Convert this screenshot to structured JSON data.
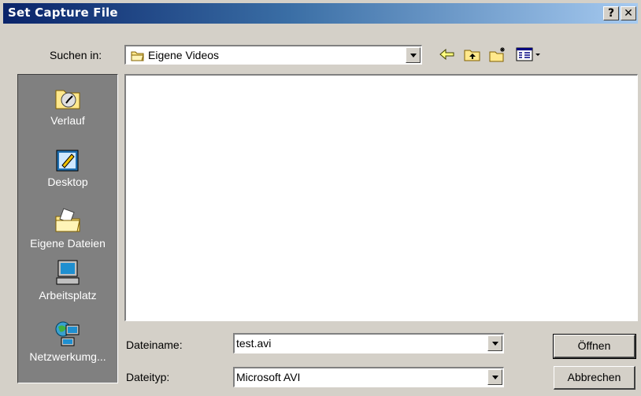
{
  "window": {
    "title": "Set Capture File",
    "help_button": "?",
    "close_button": "✕"
  },
  "lookin": {
    "label": "Suchen in:",
    "value": "Eigene Videos"
  },
  "toolbar": {
    "back_icon": "back-arrow-icon",
    "up_icon": "up-folder-icon",
    "newfolder_icon": "new-folder-icon",
    "view_icon": "view-menu-icon"
  },
  "places": [
    {
      "label": "Verlauf",
      "icon": "history-icon"
    },
    {
      "label": "Desktop",
      "icon": "desktop-icon"
    },
    {
      "label": "Eigene Dateien",
      "icon": "my-documents-icon"
    },
    {
      "label": "Arbeitsplatz",
      "icon": "my-computer-icon"
    },
    {
      "label": "Netzwerkumg...",
      "icon": "network-icon"
    }
  ],
  "filename": {
    "label": "Dateiname:",
    "value": "test.avi"
  },
  "filetype": {
    "label": "Dateityp:",
    "value": "Microsoft AVI"
  },
  "buttons": {
    "open": "Öffnen",
    "cancel": "Abbrechen"
  },
  "colors": {
    "title_start": "#0a246a",
    "title_end": "#a6caf0",
    "face": "#d4d0c8",
    "places_bg": "#808080"
  }
}
